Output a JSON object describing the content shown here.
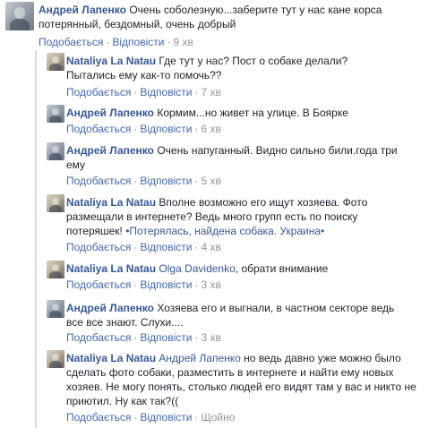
{
  "comments": [
    {
      "author": "Андрей Лапенко",
      "mention": "",
      "text": "Очень соболезную...заберите тут у нас кане корса потерянный, бездомный, очень добрый",
      "like": "Подобається",
      "reply": "Відповісти",
      "time": "9 хв"
    },
    {
      "author": "Nataliya La Natau",
      "mention": "",
      "text": "Где тут у нас? Пост о собаке делали? Пытались ему как-то помочь??",
      "like": "Подобається",
      "reply": "Відповісти",
      "time": "7 хв"
    },
    {
      "author": "Андрей Лапенко",
      "mention": "",
      "text": "Кормим...но живет на улице. В Боярке",
      "like": "Подобається",
      "reply": "Відповісти",
      "time": "6 хв"
    },
    {
      "author": "Андрей Лапенко",
      "mention": "",
      "text": "Очень напуганный. Видно сильно били.года три ему",
      "like": "Подобається",
      "reply": "Відповісти",
      "time": "5 хв"
    },
    {
      "author": "Nataliya La Natau",
      "mention": "",
      "text": "Вполне возможно его ищут хозяева. Фото размещали в интернете? Ведь много групп есть по поиску потеряшек!",
      "link": "•Потерялась, найдена собака. Украина•",
      "like": "Подобається",
      "reply": "Відповісти",
      "time": "4 хв"
    },
    {
      "author": "Nataliya La Natau",
      "mention": "Olga Davidenko",
      "text": ", обрати внимание",
      "like": "Подобається",
      "reply": "Відповісти",
      "time": "3 хв"
    },
    {
      "author": "Андрей Лапенко",
      "mention": "",
      "text": "Хозяева его и выгнали, в частном секторе ведь все все знают. Слухи....",
      "like": "Подобається",
      "reply": "Відповісти",
      "time": "3 хв"
    },
    {
      "author": "Nataliya La Natau",
      "mention": "Андрей Лапенко",
      "text": " но ведь давно уже можно было сделать фото собаки, разместить в интернете и найти ему новых хозяев. Не могу понять, столько людей его видят там у вас и никто не приютил. Ну как так?((",
      "like": "Подобається",
      "reply": "Відповісти",
      "time": "Щойно"
    }
  ]
}
